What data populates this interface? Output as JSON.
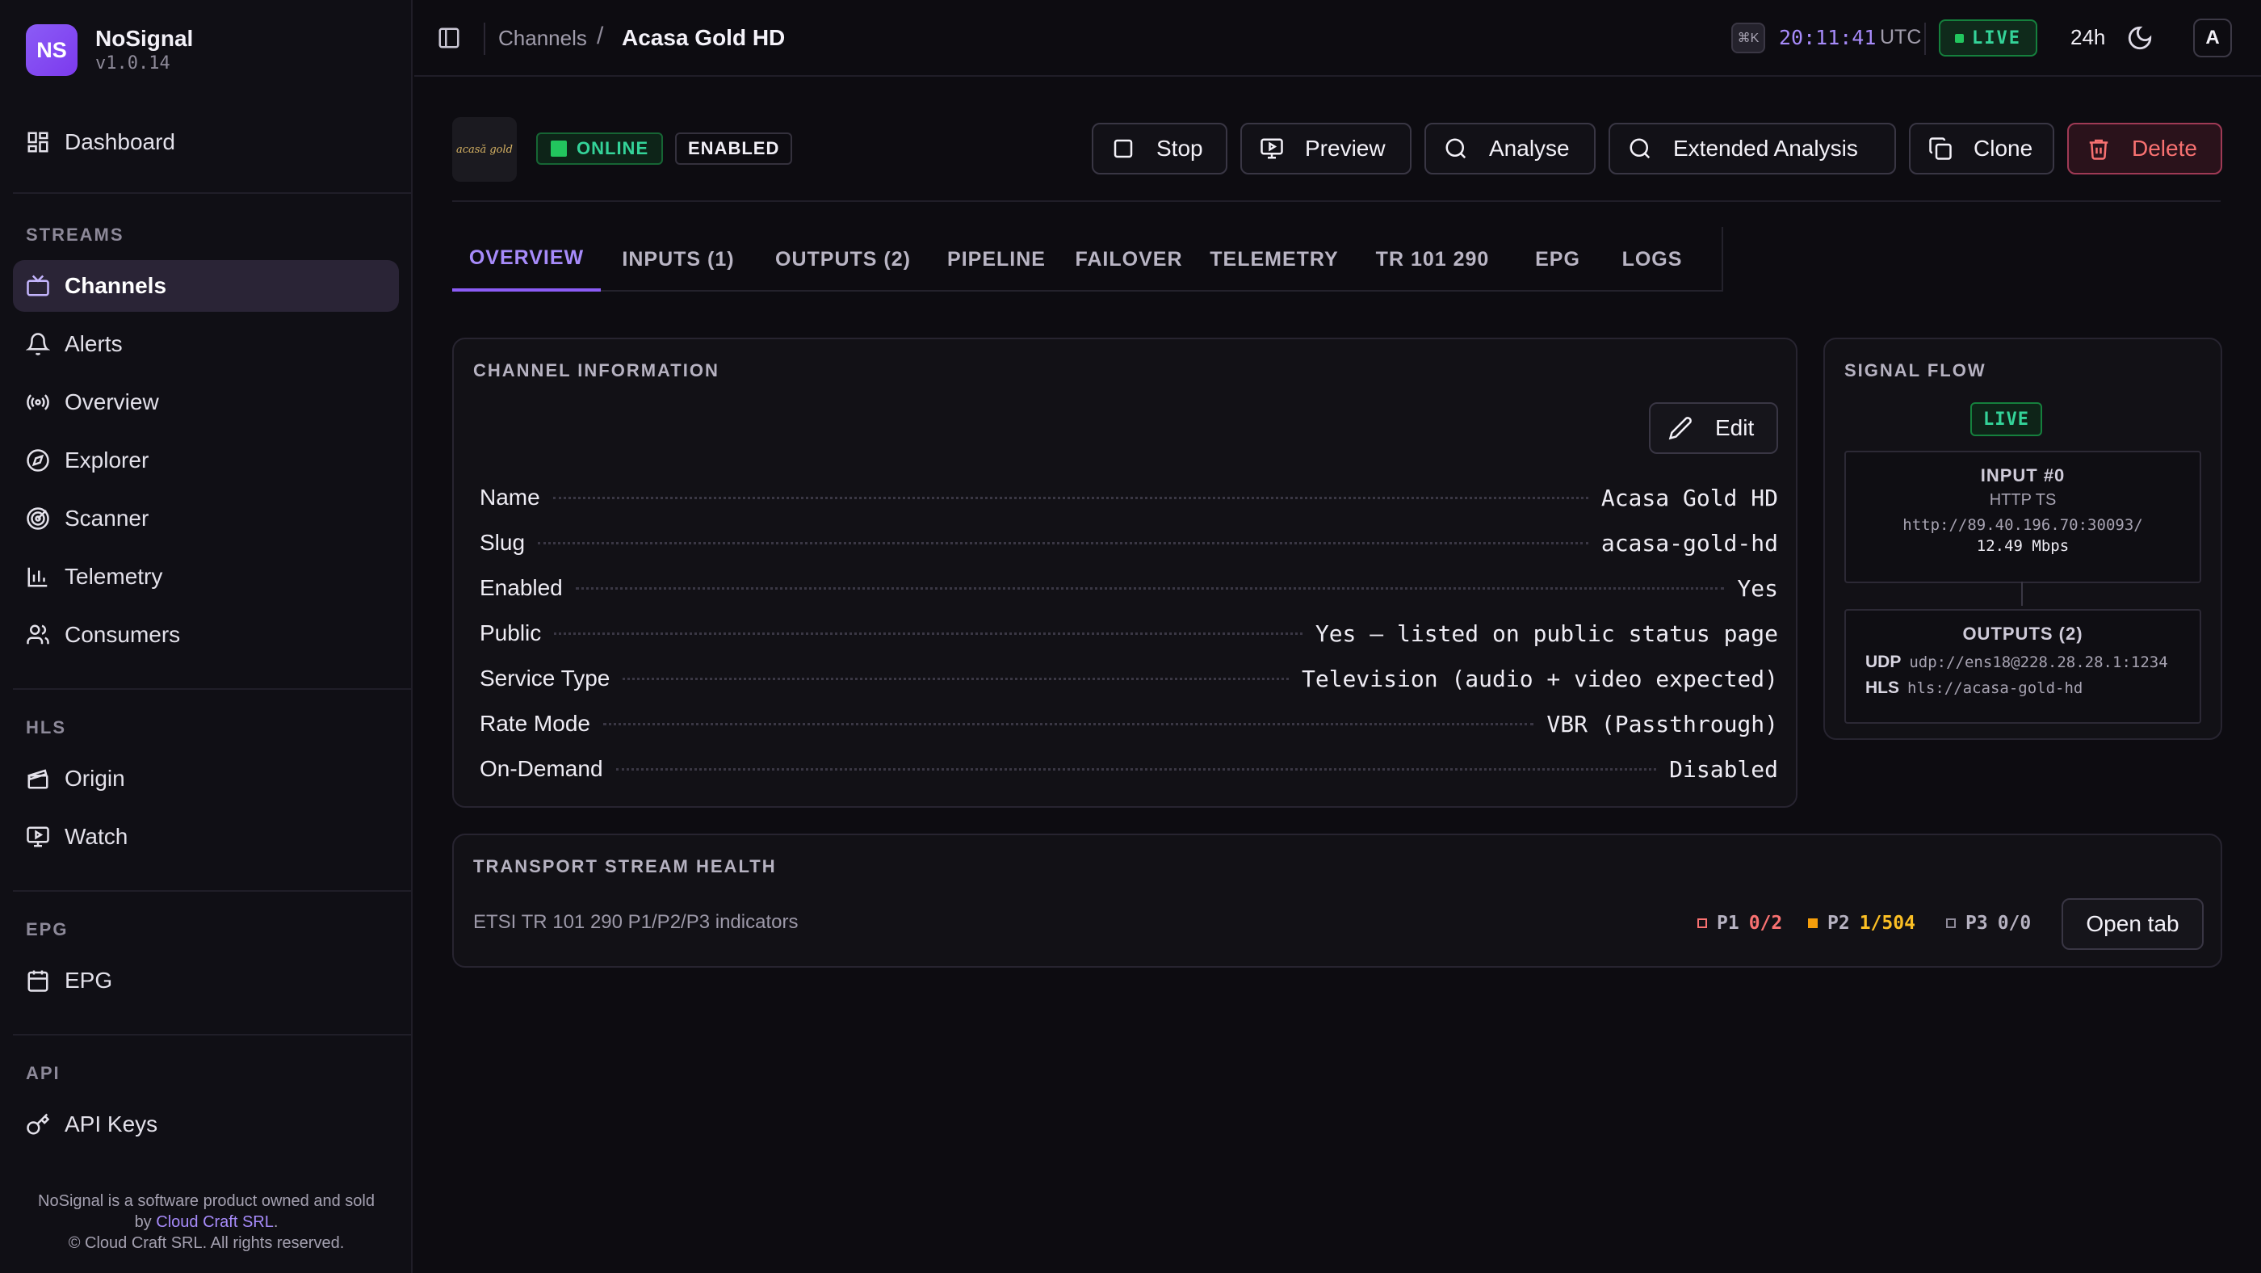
{
  "brand": {
    "logo": "NS",
    "name": "NoSignal",
    "version": "v1.0.14"
  },
  "sidebar": {
    "dashboard": "Dashboard",
    "sections": {
      "streams": "STREAMS",
      "hls": "HLS",
      "epg": "EPG",
      "api": "API"
    },
    "items": {
      "channels": "Channels",
      "alerts": "Alerts",
      "overview": "Overview",
      "explorer": "Explorer",
      "scanner": "Scanner",
      "telemetry": "Telemetry",
      "consumers": "Consumers",
      "origin": "Origin",
      "watch": "Watch",
      "epg": "EPG",
      "api_keys": "API Keys"
    },
    "footer": {
      "line1": "NoSignal is a software product owned and sold",
      "line2_prefix": "by",
      "company_link": "Cloud Craft SRL",
      "line2_suffix": ".",
      "line3": "© Cloud Craft SRL. All rights reserved."
    }
  },
  "topbar": {
    "breadcrumb_root": "Channels",
    "breadcrumb_sep": "/",
    "breadcrumb_current": "Acasa Gold HD",
    "shortcut": "⌘K",
    "clock": "20:11:41",
    "clock_tz": "UTC",
    "live": "LIVE",
    "range": "24h",
    "avatar": "A"
  },
  "channel": {
    "logo_text": "acasă gold",
    "status": "ONLINE",
    "enabled_badge": "ENABLED"
  },
  "actions": {
    "stop": "Stop",
    "preview": "Preview",
    "analyse": "Analyse",
    "extended": "Extended Analysis",
    "clone": "Clone",
    "delete": "Delete"
  },
  "tabs": [
    "OVERVIEW",
    "INPUTS (1)",
    "OUTPUTS (2)",
    "PIPELINE",
    "FAILOVER",
    "TELEMETRY",
    "TR 101 290",
    "EPG",
    "LOGS"
  ],
  "info": {
    "title": "CHANNEL INFORMATION",
    "edit": "Edit",
    "rows": [
      {
        "key": "Name",
        "value": "Acasa Gold HD"
      },
      {
        "key": "Slug",
        "value": "acasa-gold-hd"
      },
      {
        "key": "Enabled",
        "value": "Yes"
      },
      {
        "key": "Public",
        "value": "Yes — listed on public status page"
      },
      {
        "key": "Service Type",
        "value": "Television (audio + video expected)"
      },
      {
        "key": "Rate Mode",
        "value": "VBR (Passthrough)"
      },
      {
        "key": "On-Demand",
        "value": "Disabled"
      }
    ]
  },
  "signal_flow": {
    "title": "SIGNAL FLOW",
    "live": "LIVE",
    "input_title": "INPUT #0",
    "input_type": "HTTP TS",
    "input_url": "http://89.40.196.70:30093/",
    "input_rate": "12.49 Mbps",
    "outputs_title": "OUTPUTS (2)",
    "outputs": [
      {
        "proto": "UDP",
        "url": "udp://ens18@228.28.28.1:1234"
      },
      {
        "proto": "HLS",
        "url": "hls://acasa-gold-hd"
      }
    ]
  },
  "transport": {
    "title": "TRANSPORT STREAM HEALTH",
    "subtitle": "ETSI TR 101 290 P1/P2/P3 indicators",
    "p1_label": "P1",
    "p1_value": "0/2",
    "p2_label": "P2",
    "p2_value": "1/504",
    "p3_label": "P3",
    "p3_value": "0/0",
    "open_tab": "Open tab"
  },
  "colors": {
    "accent": "#8b5cf6",
    "live_green": "#22c55e",
    "p1_red": "#f87171",
    "p2_amber": "#f59e0b",
    "danger": "#f87171"
  }
}
